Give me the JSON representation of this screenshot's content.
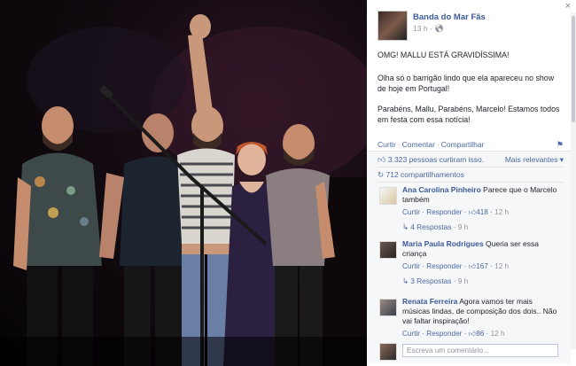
{
  "window": {
    "close_label": "×"
  },
  "page": {
    "name": "Banda do Mar Fãs",
    "time": "13 h · ",
    "globe_icon": "globe-icon"
  },
  "post": {
    "paragraph_1": "OMG! MALLU ESTÁ GRAVIDÍSSIMA!",
    "paragraph_2": "Olha só o barrigão lindo que ela apareceu no show de hoje em Portugal!",
    "paragraph_3": "Parabéns, Mallu, Parabéns, Marcelo! Estamos todos em festa com essa notícia!"
  },
  "actions": {
    "like": "Curtir",
    "comment": "Comentar",
    "share": "Compartilhar"
  },
  "stats": {
    "likes_text": "3.323 pessoas curtiram isso.",
    "relevance": "Mais relevantes ▾",
    "shares_text": "712 compartilhamentos"
  },
  "comments": [
    {
      "author": "Ana Carolina Pinheiro",
      "text": " Parece que o Marcelo também",
      "like": "Curtir",
      "reply": "Responder",
      "likes": "418",
      "time": "12 h",
      "replies_label": "4 Respostas",
      "replies_time": "9 h"
    },
    {
      "author": "Maria Paula Rodrigues",
      "text": " Queria ser essa criança",
      "like": "Curtir",
      "reply": "Responder",
      "likes": "167",
      "time": "12 h",
      "replies_label": "3 Respostas",
      "replies_time": "9 h"
    },
    {
      "author": "Renata Ferreira",
      "text": " Agora vamos ter mais músicas lindas, de composição dos dois.. Não vai faltar inspiração!",
      "like": "Curtir",
      "reply": "Responder",
      "likes": "86",
      "time": "12 h"
    }
  ],
  "composer": {
    "placeholder": "Escreva um comentário..."
  },
  "colors": {
    "link": "#3b5998",
    "muted": "#90949c",
    "panel_bg": "#ffffff",
    "stats_bg": "#f6f7f9"
  }
}
